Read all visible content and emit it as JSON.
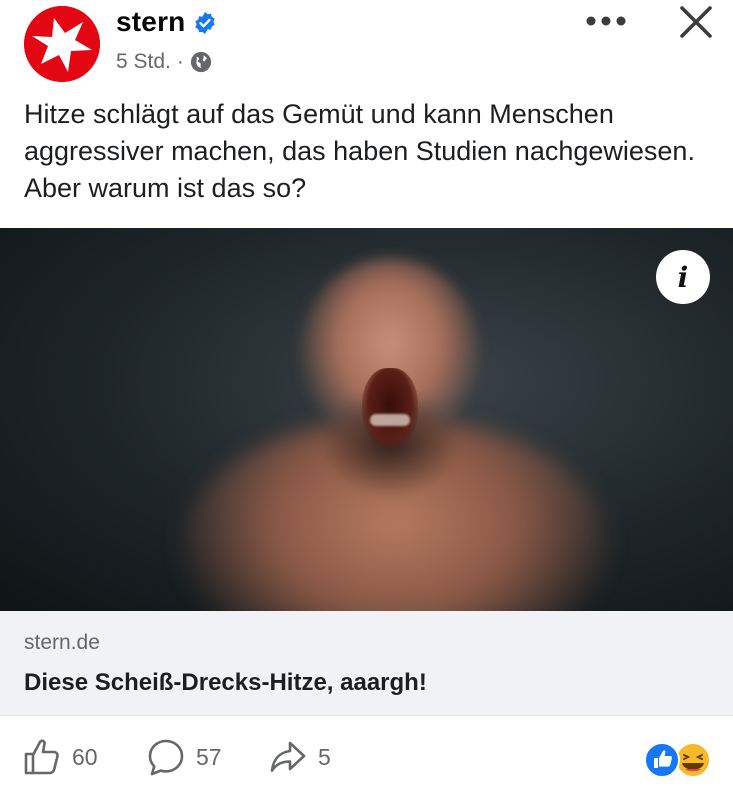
{
  "post": {
    "page_name": "stern",
    "time": "5 Std.",
    "separator": "·",
    "text": "Hitze schlägt auf das Gemüt und kann Menschen aggressiver machen, das haben Studien nachgewiesen. Aber warum ist das so?"
  },
  "icons": {
    "avatar": "stern-logo-icon",
    "verified": "verified-badge-icon",
    "privacy": "globe-icon",
    "more": "more-icon",
    "close": "close-icon",
    "info": "info-icon",
    "like": "like-icon",
    "comment": "comment-icon",
    "share": "share-icon"
  },
  "media": {
    "info_label": "i"
  },
  "link": {
    "domain": "stern.de",
    "title": "Diese Scheiß-Drecks-Hitze, aaargh!"
  },
  "actions": {
    "likes": "60",
    "comments": "57",
    "shares": "5"
  },
  "colors": {
    "brand_red": "#e30613",
    "verified_blue": "#1877f2",
    "meta_gray": "#65676b",
    "link_bg": "#f0f2f5"
  }
}
